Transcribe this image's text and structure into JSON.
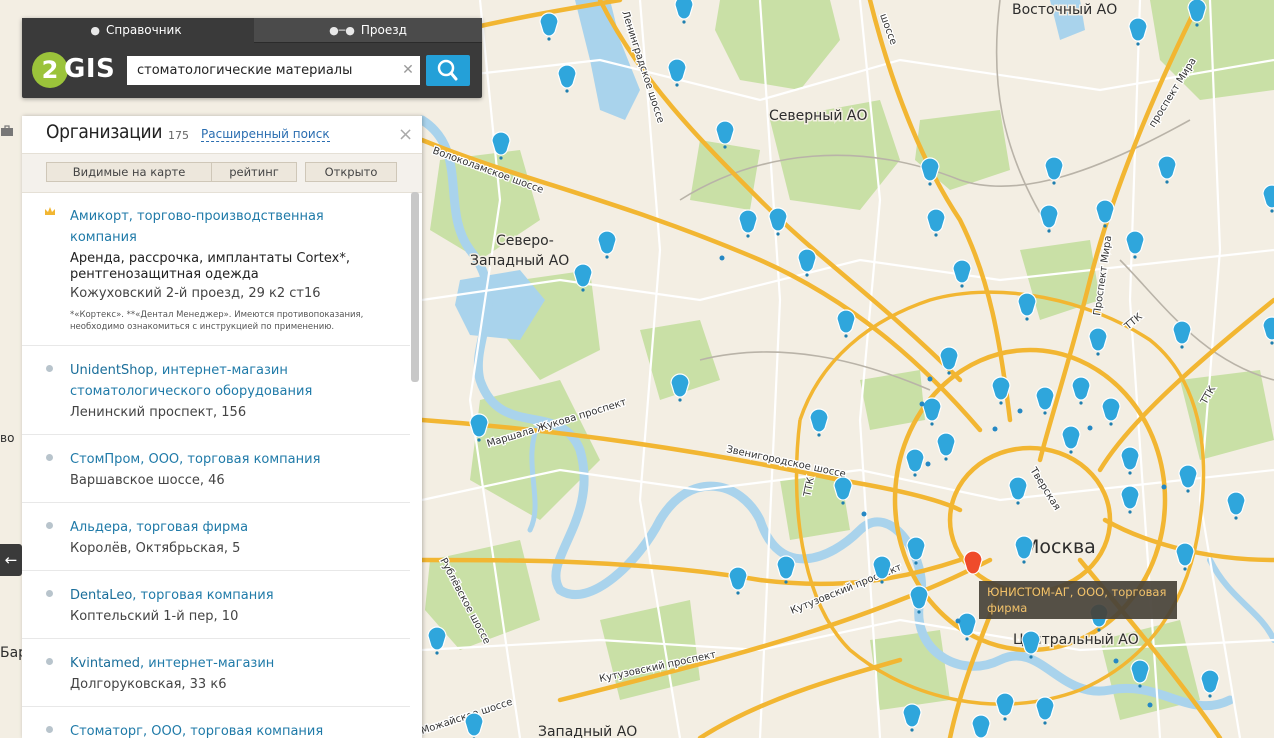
{
  "header": {
    "tabs": [
      {
        "label": "Справочник",
        "icon": "map-pin-icon",
        "active": true
      },
      {
        "label": "Проезд",
        "icon": "route-icon",
        "active": false
      }
    ],
    "logo_text": "GIS",
    "logo_digit": "2",
    "search_value": "стоматологические материалы"
  },
  "results": {
    "title": "Организации",
    "count": "175",
    "advanced_search_label": "Расширенный поиск",
    "filters": [
      "Видимые на карте",
      "рейтинг",
      "Открыто"
    ],
    "items": [
      {
        "name": "Амикорт, торгово-производственная компания",
        "brand": "",
        "premium": true,
        "desc": "Аренда, рассрочка, имплантаты Cortex*, рентгенозащитная одежда",
        "address": "Кожуховский 2-й проезд, 29 к2 ст16",
        "note": "*«Кортекс». **«Дентал Менеджер». Имеются противопоказания, необходимо ознакомиться с инструкцией по применению."
      },
      {
        "brand": "UnidentShop",
        "name": ", интернет-магазин стоматологического оборудования",
        "address": "Ленинский проспект, 156"
      },
      {
        "brand": "",
        "name": "СтомПром, ООО, торговая компания",
        "address": "Варшавское шоссе, 46"
      },
      {
        "brand": "",
        "name": "Альдера, торговая фирма",
        "address": "Королёв, Октябрьская, 5"
      },
      {
        "brand": "DentaLeo",
        "name": ", торговая компания",
        "address": "Коптельский 1-й пер, 10"
      },
      {
        "brand": "Kvintamed",
        "name": ", интернет-магазин",
        "address": "Долгоруковская, 33 к6"
      },
      {
        "brand": "",
        "name": "Стоматорг, ООО, торговая компания",
        "address": ""
      }
    ]
  },
  "map": {
    "labels": {
      "vostochny": "Восточный АО",
      "severny": "Северный АО",
      "sz1": "Северо-",
      "sz2": "Западный АО",
      "moscow": "Москва",
      "central": "Центральный АО",
      "zapadny": "Западный АО",
      "bar": "Бар",
      "vo": "во"
    },
    "streets": {
      "volokolamskoe": "Волоколамское шоссе",
      "leningradskoe": "Ленинградское шоссе",
      "zhukov": "Маршала Жукова проспект",
      "zvenigorod": "Звенигородское шоссе",
      "kutuzovsky1": "Кутузовский проспект",
      "kutuzovsky2": "Кутузовский проспект",
      "rublevskoe": "Рублёвское шоссе",
      "mozhaiskoe": "Можайское шоссе",
      "tverskaya": "Тверская",
      "mira1": "проспект Мира",
      "mira2": "Проспект Мира",
      "ttk": "ТТК",
      "ttk2": "ТТК",
      "ttk3": "ТТК",
      "shosse": "шоссе"
    },
    "tooltip": "ЮНИСТОМ-АГ, ООО, торговая фирма",
    "colors": {
      "land": "#f3eee3",
      "water": "#a9d3ec",
      "park": "#c9e0a6",
      "road_major": "#f2b632",
      "marker": "#2fa6dc",
      "marker_selected": "#ef4b2b"
    }
  }
}
